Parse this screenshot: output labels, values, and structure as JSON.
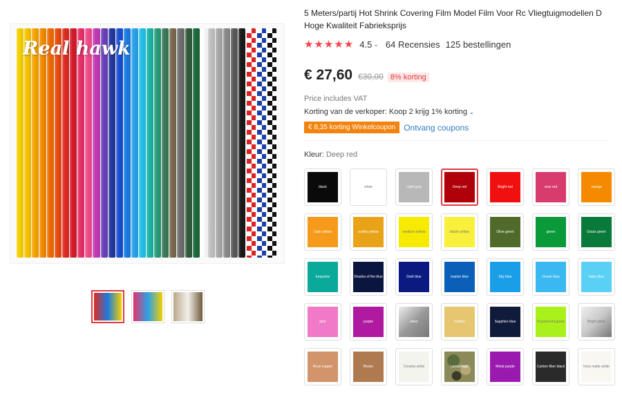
{
  "gallery": {
    "watermark": "Real hawk",
    "stripe_colors": [
      "#f5d000",
      "#f8c200",
      "#f5a300",
      "#f18a00",
      "#ef6a00",
      "#e84a10",
      "#e02a20",
      "#d41c2c",
      "#e8306a",
      "#f04a8a",
      "#c23bb6",
      "#6a3fb8",
      "#24379e",
      "#1a4fd0",
      "#1a7be0",
      "#2aa2e8",
      "#22c0e8",
      "#1ab4a6",
      "#2a9a78",
      "#3a7a5a",
      "#786a50",
      "#6e6e6e",
      "#2e5a3a",
      "#1a6a3a",
      "#ffffff",
      "#c0c0c0",
      "#a8a8a8",
      "#8a8a8a",
      "#5a5a5a",
      "#1a1a1a"
    ],
    "thumbs": [
      {
        "colors": [
          "#e02a20",
          "#1a7be0",
          "#f5d000"
        ]
      },
      {
        "colors": [
          "#e8306a",
          "#2aa2e8",
          "#f5d000"
        ]
      },
      {
        "colors": [
          "#b8a88a",
          "#f3f1ec",
          "#6e5a3a"
        ]
      }
    ]
  },
  "product": {
    "title_line1": "5 Meters/partij Hot Shrink Covering Film Model Film Voor Rc Vliegtuigmodellen D",
    "title_line2": "Hoge Kwaliteit Fabrieksprijs",
    "stars": "★★★★★",
    "rating": "4.5",
    "reviews": "64 Recensies",
    "orders": "125 bestellingen",
    "price": "€ 27,60",
    "old_price": "€30,00",
    "discount": "8% korting",
    "vat": "Price includes VAT",
    "seller_discount": "Korting van de verkoper: Koop 2 krijg 1% korting",
    "coupon_badge": "€ 8,35 korting Winkelcoupon",
    "coupon_link": "Ontvang coupons",
    "color_label": "Kleur:",
    "color_selected": "Deep red"
  },
  "swatches": [
    {
      "label": "black",
      "color": "#0a0a0a"
    },
    {
      "label": "white",
      "color": "#ffffff",
      "dark": true
    },
    {
      "label": "Light grey",
      "color": "#b8b8b8"
    },
    {
      "label": "Deep red",
      "color": "#b0000a",
      "selected": true
    },
    {
      "label": "Bright red",
      "color": "#f01010"
    },
    {
      "label": "rose red",
      "color": "#d83c6e"
    },
    {
      "label": "orange",
      "color": "#f58a00"
    },
    {
      "label": "Dark yellow",
      "color": "#f59a1a"
    },
    {
      "label": "earthy yellow",
      "color": "#e9a318"
    },
    {
      "label": "medium yellow",
      "color": "#f5ea00",
      "dark": true
    },
    {
      "label": "bluish yellow",
      "color": "#f8f03a",
      "dark": true
    },
    {
      "label": "Olive green",
      "color": "#4f6a2a"
    },
    {
      "label": "green",
      "color": "#0a9a3a"
    },
    {
      "label": "Grass green",
      "color": "#0a7a3a"
    },
    {
      "label": "turquoise",
      "color": "#0aa99a"
    },
    {
      "label": "Shades of the blue",
      "color": "#0a1640"
    },
    {
      "label": "Dark blue",
      "color": "#0a1a80"
    },
    {
      "label": "marine blue",
      "color": "#0a60b8"
    },
    {
      "label": "Sky blue",
      "color": "#1a9ee8"
    },
    {
      "label": "Ocean blue",
      "color": "#3ab8f0"
    },
    {
      "label": "baby blue",
      "color": "#5ad0f5"
    },
    {
      "label": "pink",
      "color": "#f07ac8"
    },
    {
      "label": "purple",
      "color": "#b01aa0"
    },
    {
      "label": "silver",
      "color": "#9a9a9a"
    },
    {
      "label": "Golden",
      "color": "#e6c670"
    },
    {
      "label": "Sapphire blue",
      "color": "#101a3a"
    },
    {
      "label": "Fluorescent green",
      "color": "#aaf01a",
      "dark": true
    },
    {
      "label": "Bright silver",
      "color": "#c8c8c8",
      "dark": true
    },
    {
      "label": "Rose copper",
      "color": "#d2946a"
    },
    {
      "label": "Brown",
      "color": "#b07a50"
    },
    {
      "label": "Creamy white",
      "color": "#f4f4ee",
      "dark": true
    },
    {
      "label": "camouflage",
      "color": "#8a8a5a"
    },
    {
      "label": "Metal purple",
      "color": "#9a1ab0"
    },
    {
      "label": "Carbon fiber black",
      "color": "#2a2a2a"
    },
    {
      "label": "Ivory matte white",
      "color": "#f8f7f2",
      "dark": true
    }
  ]
}
